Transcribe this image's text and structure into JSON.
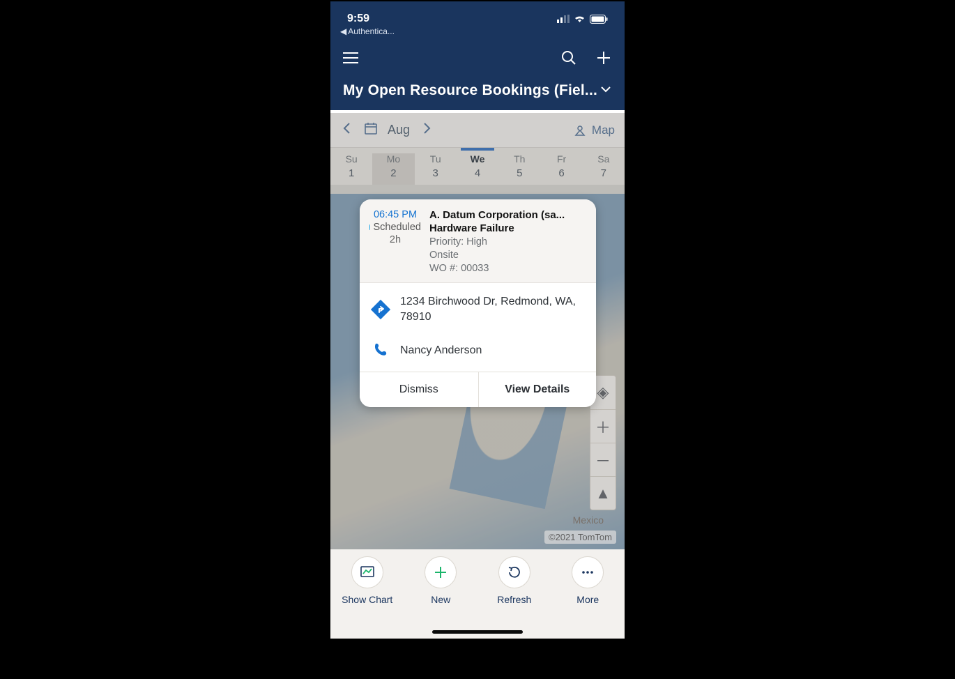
{
  "status": {
    "time": "9:59",
    "back_app": "Authentica..."
  },
  "header": {
    "title": "My Open Resource Bookings (Fiel..."
  },
  "calendar": {
    "month_label": "Aug",
    "map_label": "Map",
    "days": [
      {
        "dw": "Su",
        "dn": "1"
      },
      {
        "dw": "Mo",
        "dn": "2"
      },
      {
        "dw": "Tu",
        "dn": "3"
      },
      {
        "dw": "We",
        "dn": "4"
      },
      {
        "dw": "Th",
        "dn": "5"
      },
      {
        "dw": "Fr",
        "dn": "6"
      },
      {
        "dw": "Sa",
        "dn": "7"
      }
    ]
  },
  "booking": {
    "time": "06:45 PM",
    "status": "Scheduled",
    "duration": "2h",
    "account": "A. Datum Corporation (sa...",
    "issue": "Hardware Failure",
    "priority_line": "Priority: High",
    "location_type": "Onsite",
    "wo_line": "WO #: 00033",
    "address": "1234 Birchwood Dr, Redmond, WA, 78910",
    "contact": "Nancy Anderson",
    "dismiss_label": "Dismiss",
    "details_label": "View Details"
  },
  "map": {
    "attribution": "©2021 TomTom",
    "country_label": "Mexico"
  },
  "toolbar": {
    "items": [
      {
        "label": "Show Chart"
      },
      {
        "label": "New"
      },
      {
        "label": "Refresh"
      },
      {
        "label": "More"
      }
    ]
  }
}
